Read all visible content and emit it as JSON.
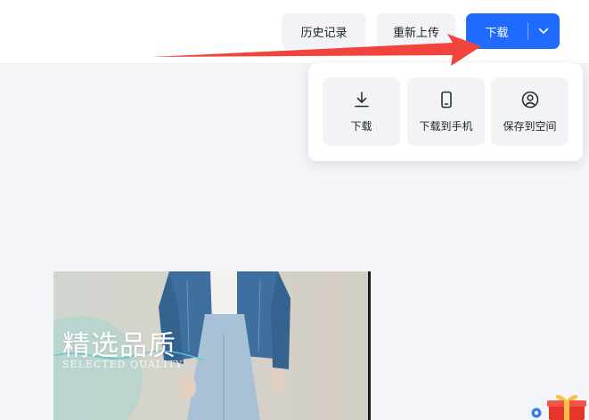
{
  "toolbar": {
    "history_label": "历史记录",
    "reupload_label": "重新上传",
    "download_label": "下载",
    "dropdown_icon": "chevron-down-icon"
  },
  "download_menu": {
    "options": [
      {
        "label": "下载",
        "icon": "download-icon"
      },
      {
        "label": "下载到手机",
        "icon": "phone-icon"
      },
      {
        "label": "保存到空间",
        "icon": "user-circle-icon"
      }
    ]
  },
  "preview": {
    "title": "精选品质",
    "subtitle": "SELECTED QUALITY"
  },
  "colors": {
    "accent": "#1f6bff",
    "annotation_arrow": "#f0443c",
    "button_gray": "#f1f3f7"
  }
}
